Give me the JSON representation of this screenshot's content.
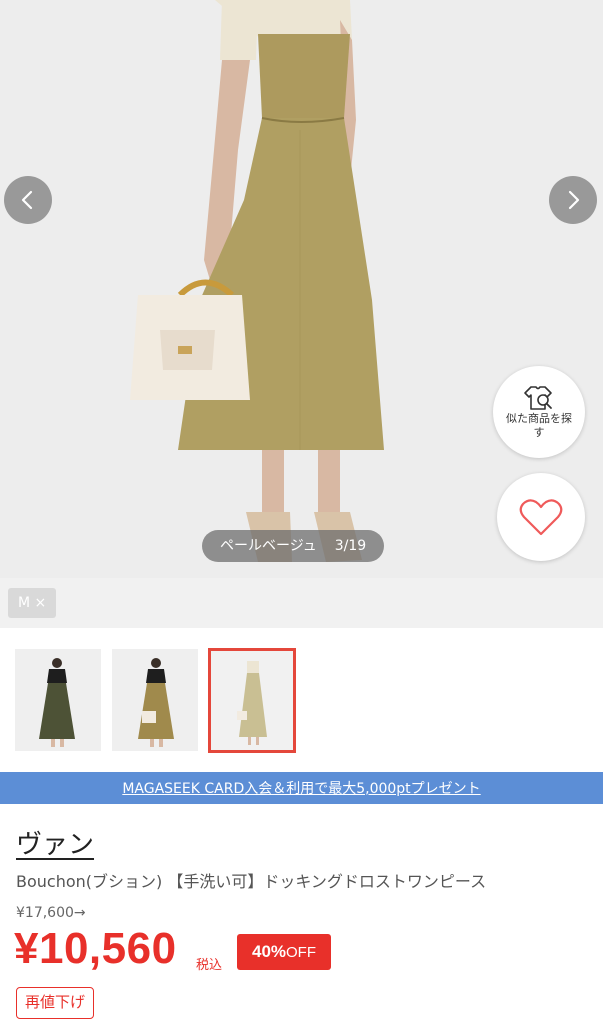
{
  "gallery": {
    "color_name": "ペールベージュ",
    "image_counter": "3/19",
    "prev_icon": "chevron-left-icon",
    "next_icon": "chevron-right-icon",
    "similar_search_label": "似た商品を探す",
    "similar_search_icon": "shirt-search-icon",
    "favorite_icon": "heart-outline-icon"
  },
  "size_filter": {
    "label": "M ×"
  },
  "thumbnails": [
    {
      "variant": "khaki",
      "selected": false
    },
    {
      "variant": "beige",
      "selected": false
    },
    {
      "variant": "pale-beige",
      "selected": true
    }
  ],
  "banner": {
    "text": "MAGASEEK CARD入会＆利用で最大5,000ptプレゼント"
  },
  "product": {
    "brand": "ヴァン",
    "name": "Bouchon(ブション) 【手洗い可】ドッキングドロストワンピース",
    "original_price": "¥17,600→",
    "price": "¥10,560",
    "tax_label": "税込",
    "discount_percent": "40%",
    "discount_suffix": "OFF",
    "reprice_label": "再値下げ"
  },
  "colors": {
    "sale_red": "#e8302a",
    "banner_blue": "#5c8ed6",
    "selected_border": "#e4473b"
  }
}
